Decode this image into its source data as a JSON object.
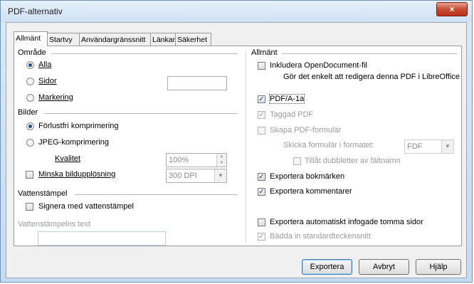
{
  "window": {
    "title": "PDF-alternativ",
    "close_glyph": "×"
  },
  "tabs": [
    {
      "label": "Allmänt",
      "active": true
    },
    {
      "label": "Startvy",
      "active": false
    },
    {
      "label": "Användargränssnitt",
      "active": false
    },
    {
      "label": "Länkar",
      "active": false
    },
    {
      "label": "Säkerhet",
      "active": false
    }
  ],
  "left": {
    "range": {
      "title": "Område",
      "all": "Alla",
      "pages": "Sidor",
      "pages_value": "",
      "selection": "Markering",
      "selected": "Alla"
    },
    "images": {
      "title": "Bilder",
      "lossless": "Förlustfri komprimering",
      "jpeg": "JPEG-komprimering",
      "quality_label": "Kvalitet",
      "quality_value": "100%",
      "reduce_label": "Minska bildupplösning",
      "reduce_value": "300 DPI",
      "selected": "Förlustfri komprimering"
    },
    "watermark": {
      "title": "Vattenstämpel",
      "sign_label": "Signera med vattenstämpel",
      "text_label": "Vattenstämpelns text",
      "text_value": ""
    }
  },
  "right": {
    "title": "Allmänt",
    "include_odf": "Inkludera OpenDocument-fil",
    "include_odf_desc": "Gör det enkelt att redigera denna PDF i LibreOffice",
    "pdfa": "PDF/A-1a",
    "tagged": "Taggad PDF",
    "create_form": "Skapa PDF-formulär",
    "submit_format_label": "Skicka formulär i formatet:",
    "submit_format_value": "FDF",
    "allow_duplicates": "Tillåt dubbletter av fältnamn",
    "export_bookmarks": "Exportera bokmärken",
    "export_comments": "Exportera kommentarer",
    "export_blank_pages": "Exportera automatiskt infogade tomma sidor",
    "embed_fonts": "Bädda in standardteckensnitt"
  },
  "buttons": {
    "export": "Exportera",
    "cancel": "Avbryt",
    "help": "Hjälp"
  },
  "icons": {
    "checkmark": "✓",
    "up": "▲",
    "down": "▼"
  }
}
